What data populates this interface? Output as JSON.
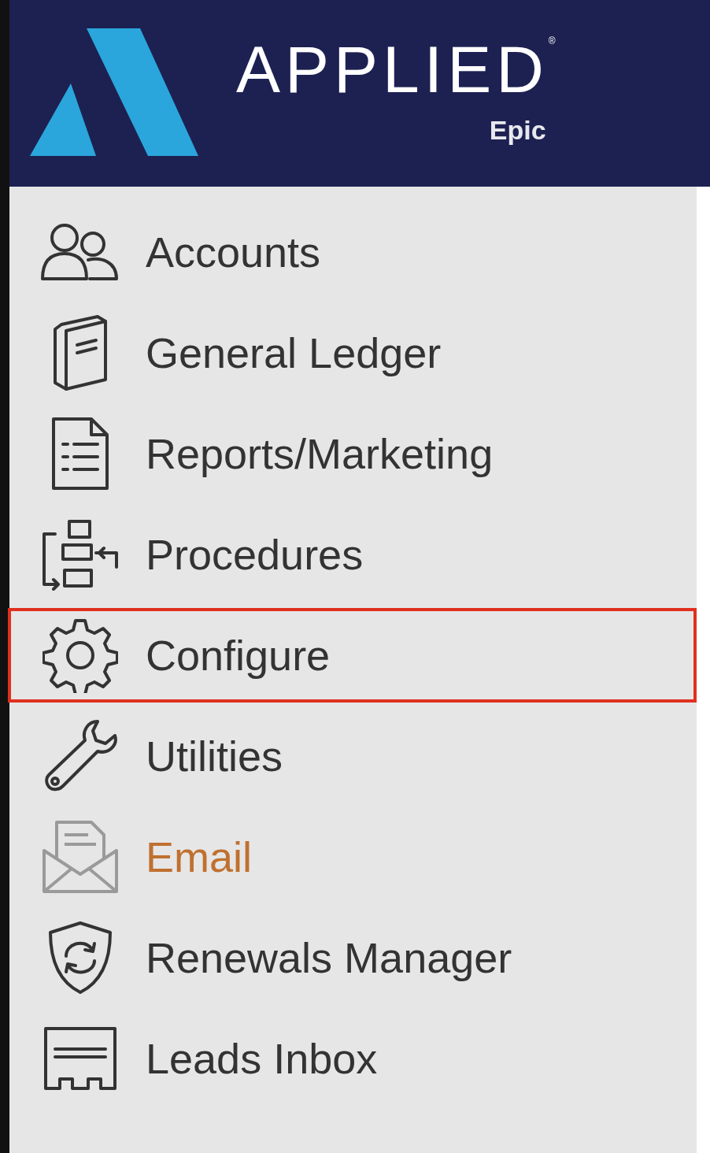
{
  "header": {
    "brand": "APPLIED",
    "product": "Epic",
    "mark": "®"
  },
  "menu": [
    {
      "label": "Accounts",
      "selected": false,
      "color": "#333333"
    },
    {
      "label": "General Ledger",
      "selected": false,
      "color": "#333333"
    },
    {
      "label": "Reports/Marketing",
      "selected": false,
      "color": "#333333"
    },
    {
      "label": "Procedures",
      "selected": false,
      "color": "#333333"
    },
    {
      "label": "Configure",
      "selected": true,
      "color": "#333333"
    },
    {
      "label": "Utilities",
      "selected": false,
      "color": "#333333"
    },
    {
      "label": "Email",
      "selected": false,
      "color": "#c0702f"
    },
    {
      "label": "Renewals Manager",
      "selected": false,
      "color": "#333333"
    },
    {
      "label": "Leads Inbox",
      "selected": false,
      "color": "#333333"
    }
  ]
}
